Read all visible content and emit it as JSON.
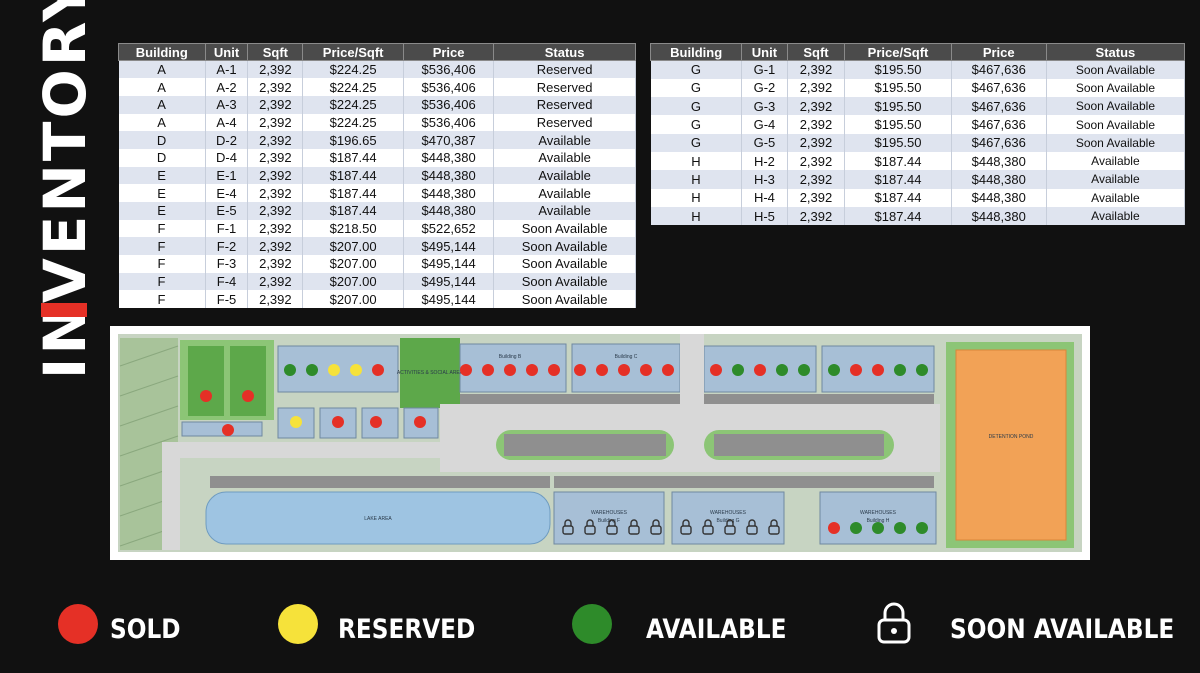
{
  "title": "INVENTORY",
  "tables": [
    {
      "headers": [
        "Building",
        "Unit",
        "Sqft",
        "Price/Sqft",
        "Price",
        "Status"
      ],
      "rows": [
        [
          "A",
          "A-1",
          "2,392",
          "$224.25",
          "$536,406",
          "Reserved"
        ],
        [
          "A",
          "A-2",
          "2,392",
          "$224.25",
          "$536,406",
          "Reserved"
        ],
        [
          "A",
          "A-3",
          "2,392",
          "$224.25",
          "$536,406",
          "Reserved"
        ],
        [
          "A",
          "A-4",
          "2,392",
          "$224.25",
          "$536,406",
          "Reserved"
        ],
        [
          "D",
          "D-2",
          "2,392",
          "$196.65",
          "$470,387",
          "Available"
        ],
        [
          "D",
          "D-4",
          "2,392",
          "$187.44",
          "$448,380",
          "Available"
        ],
        [
          "E",
          "E-1",
          "2,392",
          "$187.44",
          "$448,380",
          "Available"
        ],
        [
          "E",
          "E-4",
          "2,392",
          "$187.44",
          "$448,380",
          "Available"
        ],
        [
          "E",
          "E-5",
          "2,392",
          "$187.44",
          "$448,380",
          "Available"
        ],
        [
          "F",
          "F-1",
          "2,392",
          "$218.50",
          "$522,652",
          "Soon Available"
        ],
        [
          "F",
          "F-2",
          "2,392",
          "$207.00",
          "$495,144",
          "Soon Available"
        ],
        [
          "F",
          "F-3",
          "2,392",
          "$207.00",
          "$495,144",
          "Soon Available"
        ],
        [
          "F",
          "F-4",
          "2,392",
          "$207.00",
          "$495,144",
          "Soon Available"
        ],
        [
          "F",
          "F-5",
          "2,392",
          "$207.00",
          "$495,144",
          "Soon Available"
        ]
      ]
    },
    {
      "headers": [
        "Building",
        "Unit",
        "Sqft",
        "Price/Sqft",
        "Price",
        "Status"
      ],
      "rows": [
        [
          "G",
          "G-1",
          "2,392",
          "$195.50",
          "$467,636",
          "Soon Available"
        ],
        [
          "G",
          "G-2",
          "2,392",
          "$195.50",
          "$467,636",
          "Soon Available"
        ],
        [
          "G",
          "G-3",
          "2,392",
          "$195.50",
          "$467,636",
          "Soon Available"
        ],
        [
          "G",
          "G-4",
          "2,392",
          "$195.50",
          "$467,636",
          "Soon Available"
        ],
        [
          "G",
          "G-5",
          "2,392",
          "$195.50",
          "$467,636",
          "Soon Available"
        ],
        [
          "H",
          "H-2",
          "2,392",
          "$187.44",
          "$448,380",
          "Available"
        ],
        [
          "H",
          "H-3",
          "2,392",
          "$187.44",
          "$448,380",
          "Available"
        ],
        [
          "H",
          "H-4",
          "2,392",
          "$187.44",
          "$448,380",
          "Available"
        ],
        [
          "H",
          "H-5",
          "2,392",
          "$187.44",
          "$448,380",
          "Available"
        ]
      ]
    }
  ],
  "site_plan": {
    "building_b": "Building B",
    "building_c": "Building C",
    "warehouses": "WAREHOUSES",
    "building_f": "Building F",
    "building_g": "Building G",
    "building_h": "Building H",
    "activities": "ACTIVITIES & SOCIAL AREA",
    "lake_area": "LAKE AREA",
    "detention_pond": "DETENTION POND"
  },
  "colors": {
    "sold": "#e53026",
    "reserved": "#f6e23a",
    "available": "#2e8b2a",
    "accent": "#e53026"
  },
  "legend": [
    {
      "key": "sold",
      "label": "SOLD",
      "icon": "red-dot-icon"
    },
    {
      "key": "reserved",
      "label": "RESERVED",
      "icon": "yellow-dot-icon"
    },
    {
      "key": "available",
      "label": "AVAILABLE",
      "icon": "green-dot-icon"
    },
    {
      "key": "soon_available",
      "label": "SOON AVAILABLE",
      "icon": "padlock-icon"
    }
  ]
}
